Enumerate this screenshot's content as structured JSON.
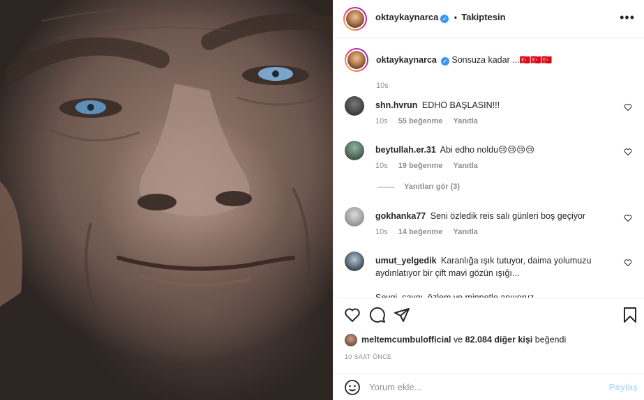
{
  "post": {
    "author": "oktaykaynarca",
    "follow_status": "Takiptesin",
    "caption": "Sonsuza kadar ...🇹🇷🇹🇷🇹🇷",
    "caption_time": "10s"
  },
  "comments": [
    {
      "user": "shn.hvrun",
      "text": "EDHO BAŞLASIN!!!",
      "time": "10s",
      "likes": "55 beğenme",
      "reply": "Yanıtla"
    },
    {
      "user": "beytullah.er.31",
      "text": "Abi edho noldu😢😢😢😢",
      "time": "10s",
      "likes": "19 beğenme",
      "reply": "Yanıtla"
    },
    {
      "user": "gokhanka77",
      "text": "Seni özledik reis salı günleri boş geçiyor",
      "time": "10s",
      "likes": "14 beğenme",
      "reply": "Yanıtla"
    },
    {
      "user": "umut_yelgedik",
      "text": "Karanlığa ışık tutuyor, daima yolumuzu aydınlatıyor bir çift mavi gözün ışığı...",
      "text2": "Sevgi, saygı, özlem ve minnetle anıyoruz."
    }
  ],
  "view_replies": "Yanıtları gör (3)",
  "likes": {
    "user": "meltemcumbulofficial",
    "connector": "ve",
    "others": "82.084 diğer kişi",
    "suffix": "beğendi"
  },
  "timestamp": "10 SAAT ÖNCE",
  "add_comment": {
    "placeholder": "Yorum ekle...",
    "post_label": "Paylaş"
  },
  "colors": {
    "verified": "#3897f0",
    "post_disabled": "#b2dffc",
    "meta": "#8e8e8e"
  }
}
